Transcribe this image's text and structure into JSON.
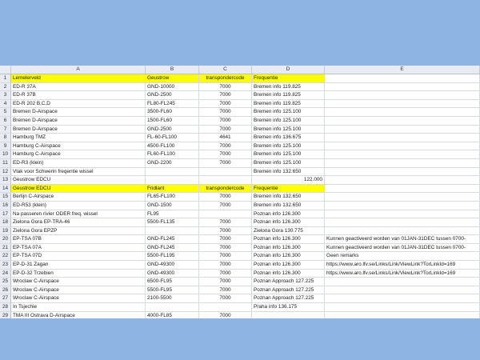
{
  "columns": [
    "A",
    "B",
    "C",
    "D",
    "E"
  ],
  "rows": [
    {
      "n": "1",
      "a": "Lemelerveld",
      "b": "Geustrow",
      "c": "transpondercode",
      "d": "Frequentie",
      "e": "",
      "hl": true
    },
    {
      "n": "2",
      "a": "ED-R 37A",
      "b": "GND-10000",
      "c": "7000",
      "d": "Bremen info 119.825",
      "e": ""
    },
    {
      "n": "3",
      "a": "ED-R 37B",
      "b": "GND-2500",
      "c": "7000",
      "d": "Bremen info 119.825",
      "e": ""
    },
    {
      "n": "4",
      "a": "ED-R 202 B,C,D",
      "b": "FL80-FL245",
      "c": "7000",
      "d": "Bremen info 119.825",
      "e": ""
    },
    {
      "n": "5",
      "a": "Bremen D-Airspace",
      "b": "3500-FL60",
      "c": "7000",
      "d": "Bremen info 125.100",
      "e": ""
    },
    {
      "n": "6",
      "a": "Bremen D-Airspace",
      "b": "1500-FL60",
      "c": "7000",
      "d": "Bremen info 125.100",
      "e": ""
    },
    {
      "n": "7",
      "a": "Bremen D-Airspace",
      "b": "GND-2500",
      "c": "7000",
      "d": "Bremen info 125.100",
      "e": ""
    },
    {
      "n": "8",
      "a": "Hamburg TMZ",
      "b": "FL-60-FL100",
      "c": "4641",
      "d": "Bremen info 136.675",
      "e": ""
    },
    {
      "n": "9",
      "a": "Hamburg C-Airspace",
      "b": "4500-FL100",
      "c": "7000",
      "d": "Bremen info 125.100",
      "e": ""
    },
    {
      "n": "10",
      "a": "Hamburg C-Airspace",
      "b": "FL60-FL100",
      "c": "7000",
      "d": "Bremen info 125.100",
      "e": ""
    },
    {
      "n": "11",
      "a": "ED-R3 (klein)",
      "b": "GND-2200",
      "c": "7000",
      "d": "Bremen info 125.100",
      "e": ""
    },
    {
      "n": "12",
      "a": "Vlak voor Schwerin freqentie wissel",
      "b": "",
      "c": "",
      "d": "Bremen info 132.650",
      "e": ""
    },
    {
      "n": "13",
      "a": "Geustrow  EDCU",
      "b": "",
      "c": "",
      "d": "122.000",
      "d_right": true,
      "e": ""
    },
    {
      "n": "14",
      "a": "Geustrow  EDCU",
      "b": "Fridlant",
      "c": "transpondercode",
      "d": "Frequentie",
      "e": "",
      "hl": true
    },
    {
      "n": "15",
      "a": "Berlijn C-Airspace",
      "b": "FL65-FL100",
      "c": "7000",
      "d": "Bremen info 132.650",
      "e": ""
    },
    {
      "n": "16",
      "a": "ED-R53 (klein)",
      "b": "GND-1500",
      "c": "7000",
      "d": "Bremen info 132.650",
      "e": ""
    },
    {
      "n": "17",
      "a": "Na passeren rivier ODER  freq. wissel",
      "b": "FL95",
      "c": "",
      "d": "Poznan info 126.300",
      "e": ""
    },
    {
      "n": "18",
      "a": "Zielona Gora EP-TRA-46",
      "b": "5500-FL135",
      "c": "7000",
      "d": "Poznan info 126.300",
      "e": ""
    },
    {
      "n": "19",
      "a": "Zielona Gora EPZP",
      "b": "",
      "c": "7000",
      "d": "Zielona Gora 130.775",
      "e": ""
    },
    {
      "n": "20",
      "a": "EP-TSA 07B",
      "b": "GND-FL245",
      "c": "7000",
      "d": "Poznan info 126.300",
      "e": "Kunnen geactiveerd worden van 01JAN-31DEC tussen 0700-"
    },
    {
      "n": "21",
      "a": "EP-TSA 07A",
      "b": "GND-FL245",
      "c": "7000",
      "d": "Poznan info 126.300",
      "e": "Kunnen geactiveerd worden van 01JAN-31DEC tussen 0700-"
    },
    {
      "n": "22",
      "a": "EP-TSA 07D",
      "b": "5500-FL195",
      "c": "7000",
      "d": "Poznan info 126.300",
      "e": "Geen remarks"
    },
    {
      "n": "23",
      "a": "EP-D-31 Zagan",
      "b": "GND-49300",
      "c": "7000",
      "d": "Poznan info 126.300",
      "e": "https://www.aro.lfv.se/Links/Link/ViewLink?TorLinkId=169"
    },
    {
      "n": "24",
      "a": "EP-D-32 Trzebien",
      "b": "GND-49300",
      "c": "7000",
      "d": "Poznan info 126.300",
      "e": "https://www.aro.lfv.se/Links/Link/ViewLink?TorLinkId=169"
    },
    {
      "n": "25",
      "a": "Wroclaw C-Airspace",
      "b": "6500-FL95",
      "c": "7000",
      "d": "Poznan Approach 127.225",
      "e": ""
    },
    {
      "n": "26",
      "a": "Wroclaw C-Airspace",
      "b": "5500-FL95",
      "c": "7000",
      "d": "Poznan Approach 127.225",
      "e": ""
    },
    {
      "n": "27",
      "a": "Wroclaw C-Airspace",
      "b": "2100-5500",
      "c": "7000",
      "d": "Poznan Approach 127.225",
      "e": ""
    },
    {
      "n": "28",
      "a": "In Tsjechie",
      "b": "",
      "c": "",
      "d": "Praha info 136.175",
      "e": ""
    },
    {
      "n": "29",
      "a": "TMA III Ostrava D-Airspace",
      "b": "4000-FL85",
      "c": "7000",
      "d": "",
      "e": ""
    }
  ]
}
